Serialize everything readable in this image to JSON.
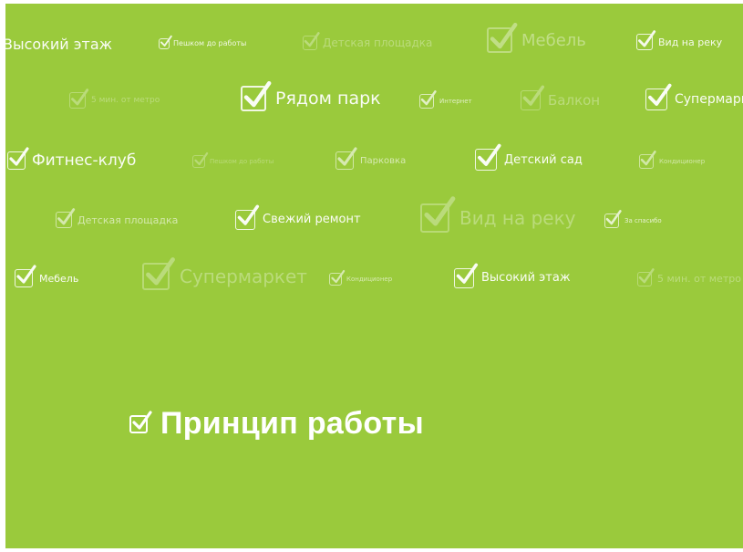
{
  "background_color": "#9aca3c",
  "text_color": "#ffffff",
  "title": "Принцип работы",
  "tags": [
    "Высокий этаж",
    "Пешком до работы",
    "Детская площадка",
    "Мебель",
    "Вид на реку",
    "5 мин. от метро",
    "Рядом парк",
    "Интернет",
    "Балкон",
    "Супермаркет",
    "Фитнес-клуб",
    "Пешком до работы",
    "Парковка",
    "Детский сад",
    "Кондиционер",
    "Детская площадка",
    "Свежий ремонт",
    "Вид на реку",
    "За спасибо",
    "Мебель",
    "Супермаркет",
    "Кондиционер",
    "Высокий этаж",
    "5 мин. от метро"
  ],
  "icons": {
    "check": "checkbox-checked-icon"
  }
}
